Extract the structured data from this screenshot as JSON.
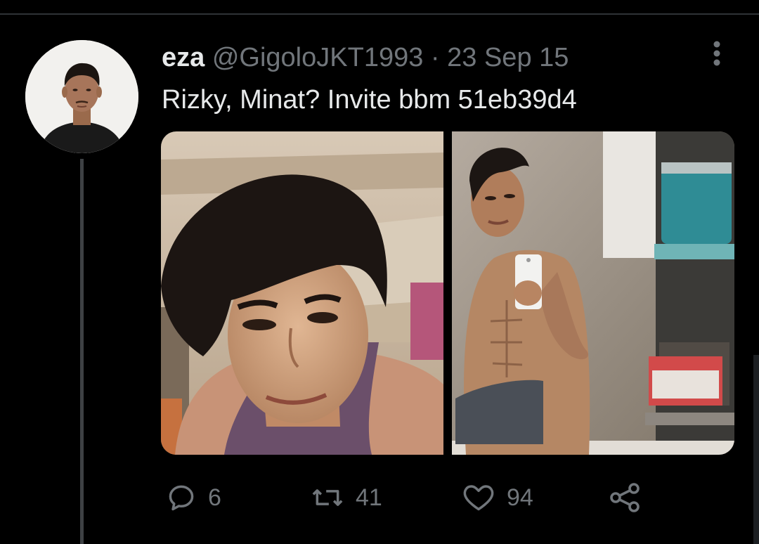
{
  "tweet": {
    "display_name": "eza",
    "handle": "@GigoloJKT1993",
    "separator": "·",
    "date": "23 Sep 15",
    "text": "Rizky, Minat? Invite bbm 51eb39d4",
    "avatar_icon": "profile-photo",
    "more_icon": "more-vertical-icon",
    "media": [
      {
        "alt": "selfie photo of young man in purple tank top"
      },
      {
        "alt": "mirror selfie photo of shirtless young man holding phone"
      }
    ],
    "actions": {
      "reply": {
        "icon": "reply-icon",
        "count": "6"
      },
      "retweet": {
        "icon": "retweet-icon",
        "count": "41"
      },
      "like": {
        "icon": "heart-icon",
        "count": "94"
      },
      "share": {
        "icon": "share-icon"
      }
    }
  },
  "colors": {
    "background": "#000000",
    "text_primary": "#e7e9ea",
    "text_secondary": "#71767b",
    "divider": "#2f3336"
  }
}
